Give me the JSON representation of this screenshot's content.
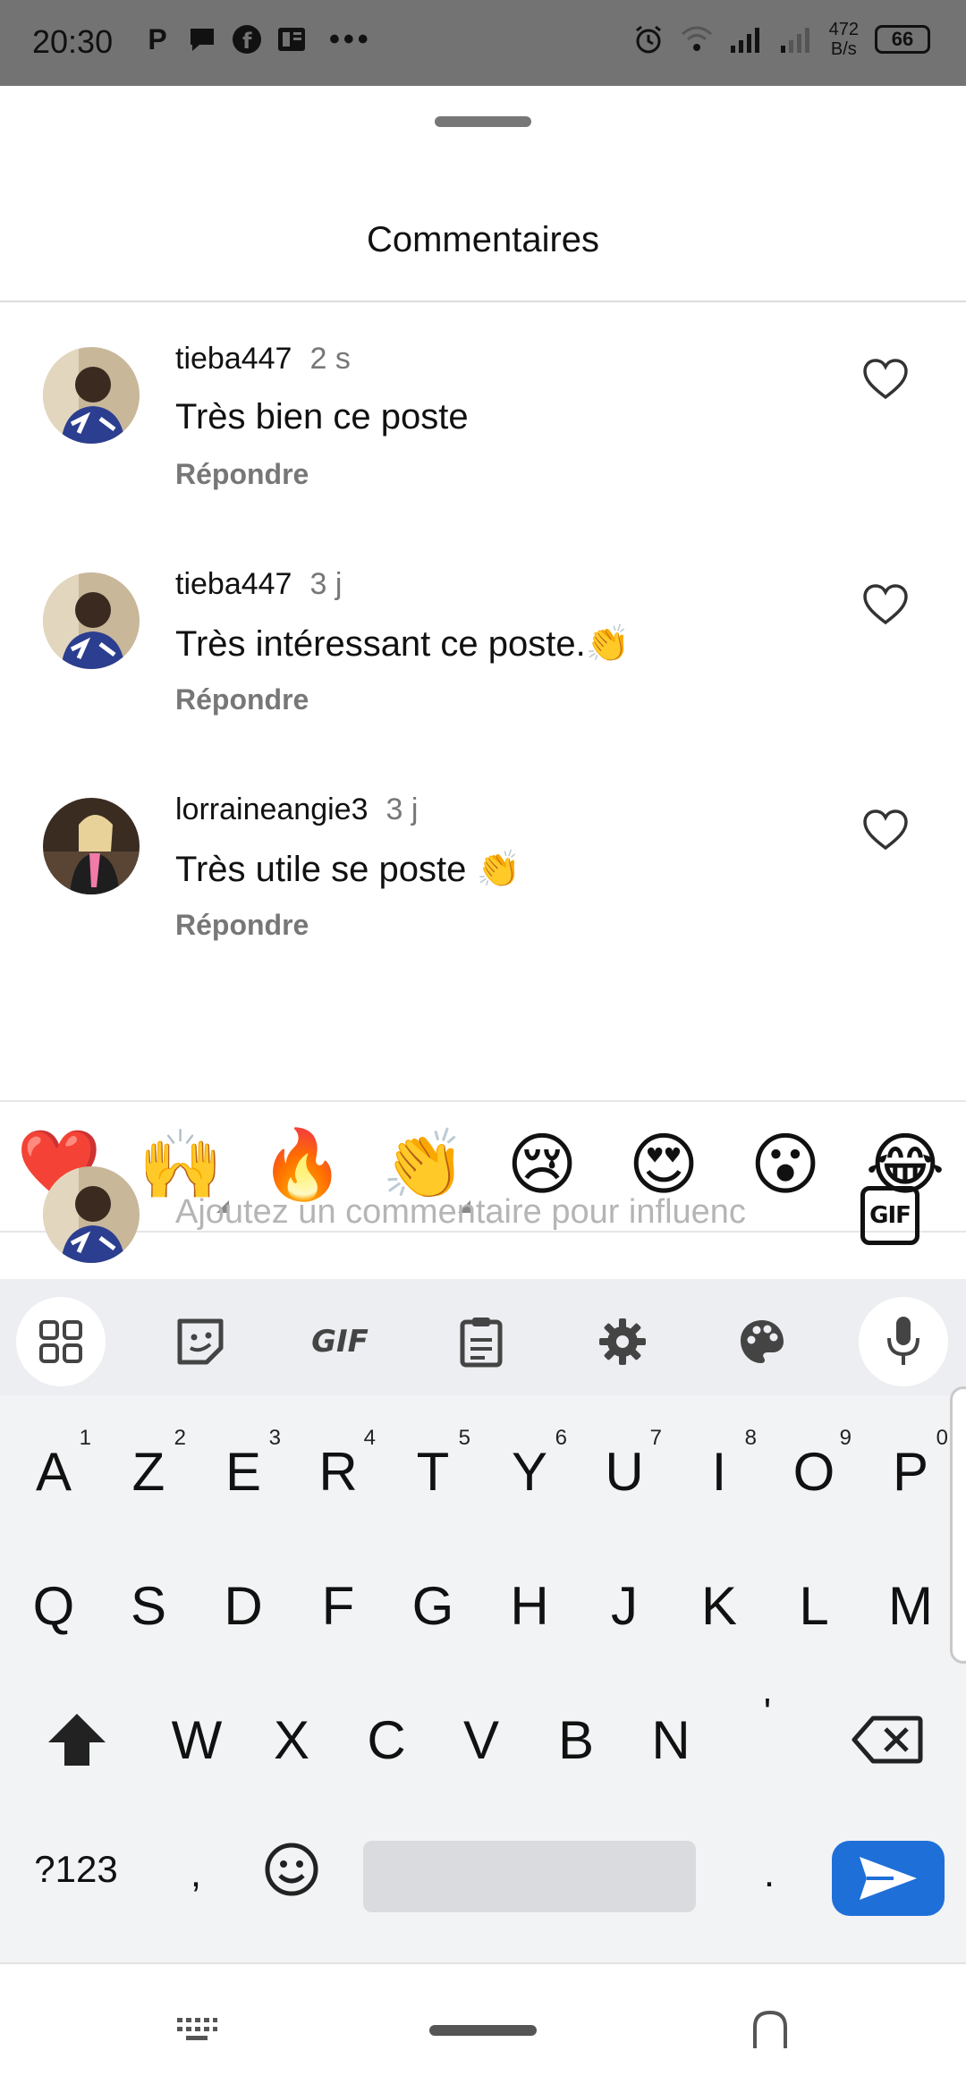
{
  "status_bar": {
    "time": "20:30",
    "left_icons": [
      "p-icon",
      "chat-icon",
      "facebook-icon",
      "news-icon"
    ],
    "more": "•••",
    "speed_value": "472",
    "speed_unit": "B/s",
    "battery": "66"
  },
  "sheet": {
    "title": "Commentaires"
  },
  "comments": [
    {
      "user": "tieba447",
      "time": "2 s",
      "text": "Très bien ce poste",
      "reply": "Répondre"
    },
    {
      "user": "tieba447",
      "time": "3 j",
      "text": "Très intéressant ce poste.👏",
      "reply": "Répondre"
    },
    {
      "user": "lorraineangie3",
      "time": "3 j",
      "text": "Très utile se poste 👏",
      "reply": "Répondre"
    }
  ],
  "reactions": [
    "❤️",
    "🙌",
    "🔥",
    "👏",
    "😢",
    "😍",
    "😮",
    "😂"
  ],
  "compose": {
    "placeholder": "Ajoutez un commentaire pour influenc",
    "gif_label": "GIF"
  },
  "keyboard": {
    "toolbar": {
      "gif": "GIF"
    },
    "row1": [
      {
        "k": "A",
        "s": "1"
      },
      {
        "k": "Z",
        "s": "2"
      },
      {
        "k": "E",
        "s": "3"
      },
      {
        "k": "R",
        "s": "4"
      },
      {
        "k": "T",
        "s": "5"
      },
      {
        "k": "Y",
        "s": "6"
      },
      {
        "k": "U",
        "s": "7"
      },
      {
        "k": "I",
        "s": "8"
      },
      {
        "k": "O",
        "s": "9"
      },
      {
        "k": "P",
        "s": "0"
      }
    ],
    "row2": [
      "Q",
      "S",
      "D",
      "F",
      "G",
      "H",
      "J",
      "K",
      "L",
      "M"
    ],
    "row3": [
      "W",
      "X",
      "C",
      "V",
      "B",
      "N",
      "'"
    ],
    "symbols_label": "?123",
    "comma": ",",
    "period": "."
  }
}
